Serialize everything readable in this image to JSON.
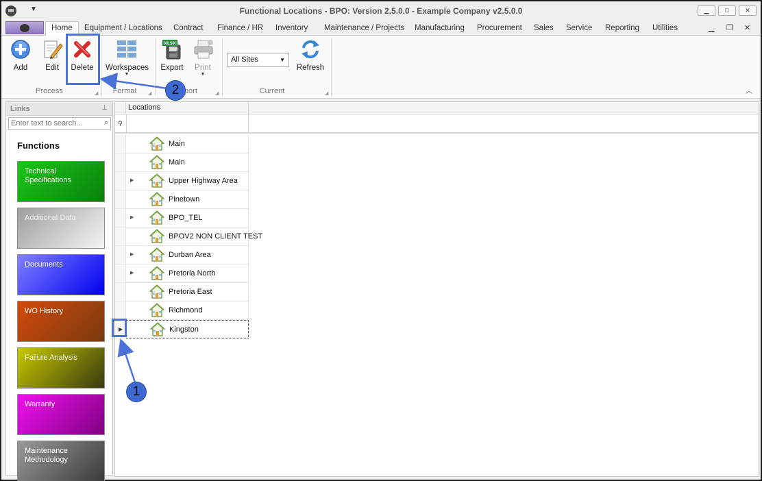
{
  "window": {
    "title": "Functional Locations - BPO: Version 2.5.0.0 - Example Company v2.5.0.0"
  },
  "menu_tabs": [
    "Home",
    "Equipment / Locations",
    "Contract",
    "Finance / HR",
    "Inventory",
    "Maintenance / Projects",
    "Manufacturing",
    "Procurement",
    "Sales",
    "Service",
    "Reporting",
    "Utilities"
  ],
  "ribbon": {
    "add": "Add",
    "edit": "Edit",
    "delete": "Delete",
    "workspaces": "Workspaces",
    "export": "Export",
    "print": "Print",
    "refresh": "Refresh",
    "site_value": "All Sites",
    "groups": {
      "process": "Process",
      "format": "Format",
      "export": "Export",
      "current": "Current"
    }
  },
  "links_panel": {
    "title": "Links",
    "search_placeholder": "Enter text to search...",
    "functions_label": "Functions",
    "tiles": [
      {
        "label": "Technical Specifications",
        "color": "#10b010"
      },
      {
        "label": "Additional Data",
        "color": "#c8c8c8"
      },
      {
        "label": "Documents",
        "color": "#3a3aff"
      },
      {
        "label": "WO History",
        "color": "#b84a0a"
      },
      {
        "label": "Failure Analysis",
        "color": "#a0a000"
      },
      {
        "label": "Warranty",
        "color": "#c010c0"
      },
      {
        "label": "Maintenance Methodology",
        "color": "#555555"
      }
    ]
  },
  "grid": {
    "column_header": "Locations",
    "rows": [
      {
        "label": "Main",
        "expandable": false
      },
      {
        "label": "Main",
        "expandable": false
      },
      {
        "label": "Upper Highway Area",
        "expandable": true
      },
      {
        "label": "Pinetown",
        "expandable": false
      },
      {
        "label": "BPO_TEL",
        "expandable": true
      },
      {
        "label": "BPOV2 NON CLIENT TEST",
        "expandable": false
      },
      {
        "label": "Durban Area",
        "expandable": true
      },
      {
        "label": "Pretoria North",
        "expandable": true
      },
      {
        "label": "Pretoria East",
        "expandable": false
      },
      {
        "label": "Richmond",
        "expandable": false
      },
      {
        "label": "Kingston",
        "expandable": false
      }
    ],
    "selected_row": "Kingston"
  },
  "annotations": {
    "callout_1": "1",
    "callout_2": "2",
    "accent": "#4a72d9"
  }
}
